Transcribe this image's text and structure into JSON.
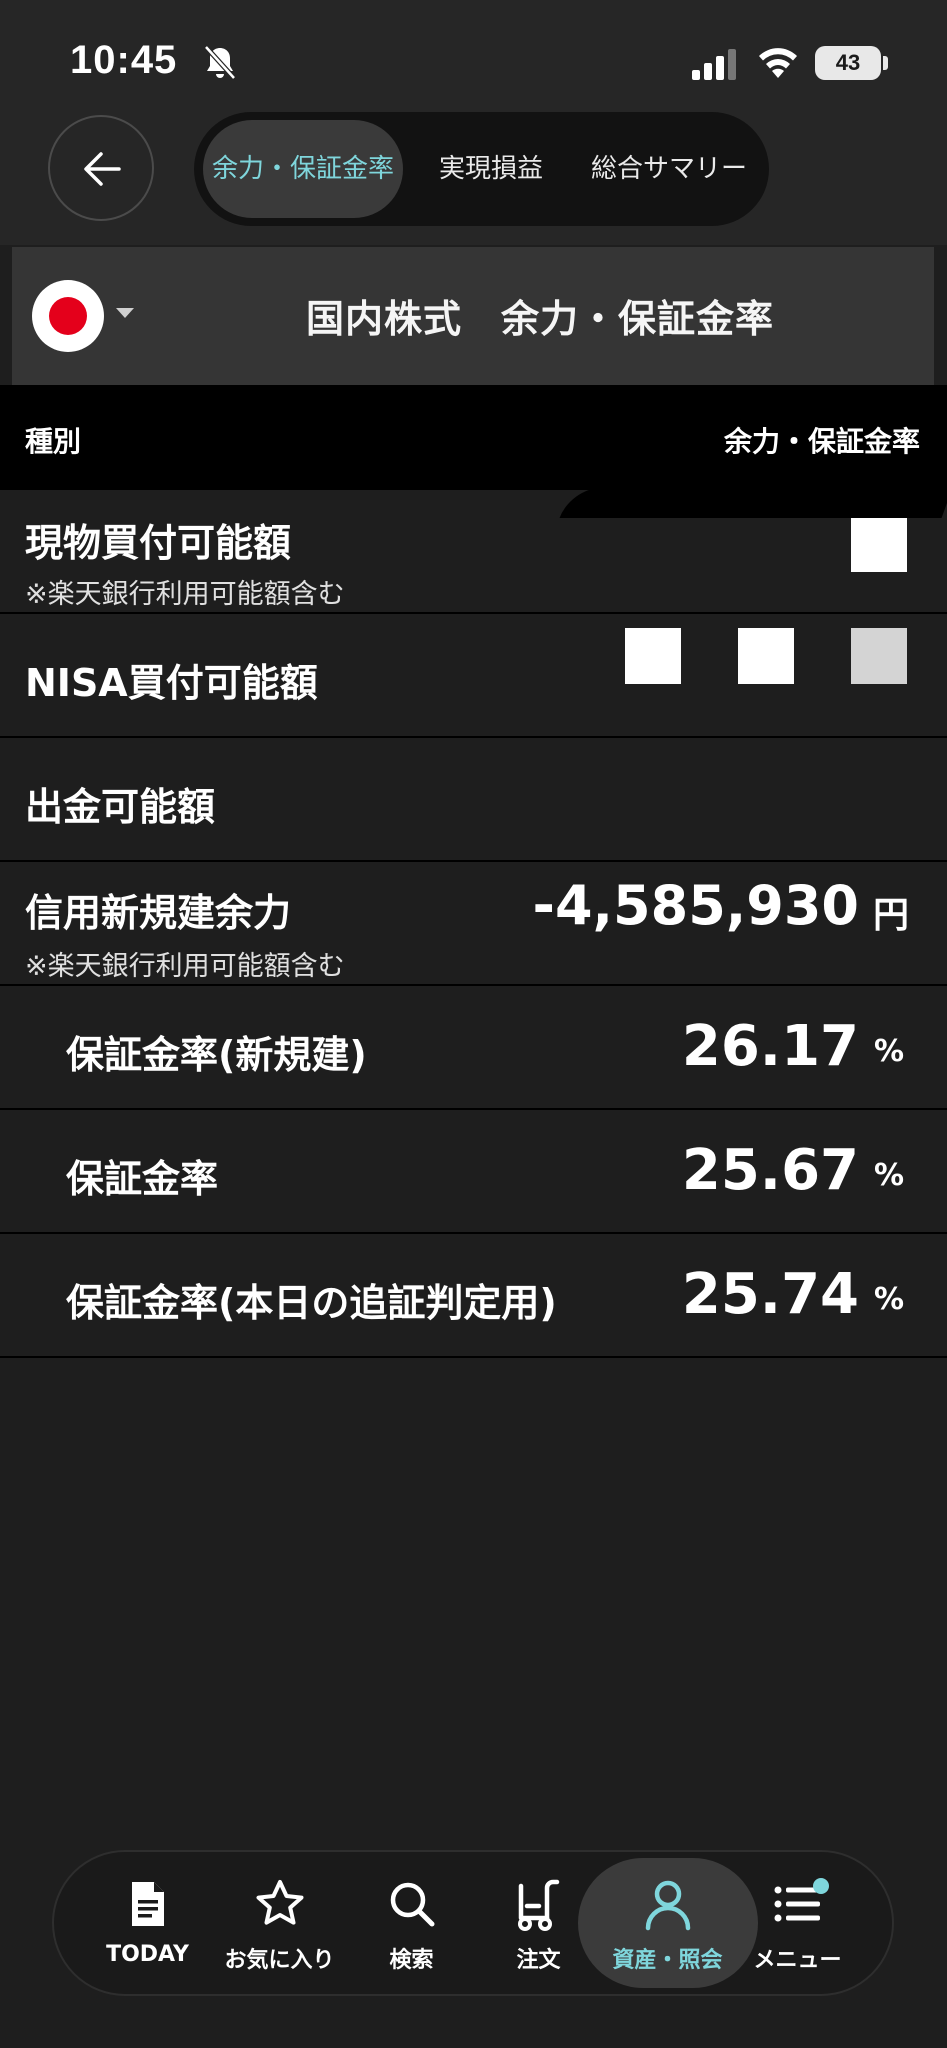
{
  "status_bar": {
    "time": "10:45",
    "battery": "43"
  },
  "top_nav": {
    "tabs": [
      {
        "label": "余力・保証金率",
        "active": true
      },
      {
        "label": "実現損益",
        "active": false
      },
      {
        "label": "総合サマリー",
        "active": false
      }
    ]
  },
  "section": {
    "title": "国内株式　余力・保証金率",
    "market_flag": "japan-flag-icon"
  },
  "table_header": {
    "left": "種別",
    "right": "余力・保証金率"
  },
  "rows": [
    {
      "label": "現物買付可能額",
      "note": "※楽天銀行利用可能額含む",
      "value": "",
      "unit": ""
    },
    {
      "label": "NISA買付可能額",
      "value": "",
      "unit": ""
    },
    {
      "label": "出金可能額",
      "value": "",
      "unit": ""
    },
    {
      "label": "信用新規建余力",
      "note": "※楽天銀行利用可能額含む",
      "value": "-4,585,930",
      "unit": "円"
    },
    {
      "label": "保証金率(新規建)",
      "value": "26.17",
      "unit": "%"
    },
    {
      "label": "保証金率",
      "value": "25.67",
      "unit": "%"
    },
    {
      "label": "保証金率(本日の追証判定用)",
      "value": "25.74",
      "unit": "%"
    }
  ],
  "tab_bar": {
    "items": [
      {
        "label": "TODAY",
        "icon": "document-icon"
      },
      {
        "label": "お気に入り",
        "icon": "star-icon"
      },
      {
        "label": "検索",
        "icon": "search-icon"
      },
      {
        "label": "注文",
        "icon": "order-icon"
      },
      {
        "label": "資産・照会",
        "icon": "person-icon",
        "active": true
      },
      {
        "label": "メニュー",
        "icon": "menu-icon"
      }
    ]
  },
  "colors": {
    "accent": "#7fd6dc",
    "background": "#1e1e1e",
    "header": "#353535"
  }
}
